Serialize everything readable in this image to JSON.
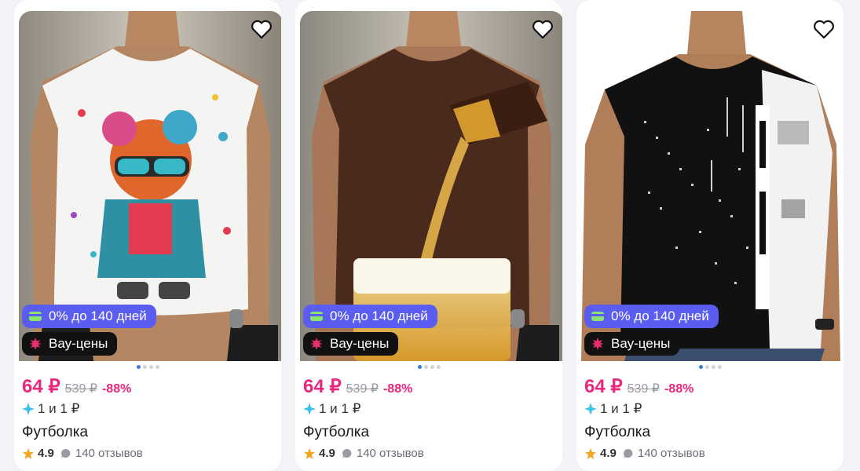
{
  "products": [
    {
      "image_desc": "teddy-bear-print-tshirt",
      "tshirt_color": "#f4f4f2",
      "installment_badge": "0% до 140 дней",
      "wow_badge": "Вау-цены",
      "price": "64 ₽",
      "old_price": "539 ₽",
      "discount": "-88%",
      "split_payment": "1 и 1 ₽",
      "title": "Футболка",
      "rating": "4.9",
      "reviews": "140 отзывов"
    },
    {
      "image_desc": "beer-pour-print-tshirt",
      "tshirt_color": "#4a2a1c",
      "installment_badge": "0% до 140 дней",
      "wow_badge": "Вау-цены",
      "price": "64 ₽",
      "old_price": "539 ₽",
      "discount": "-88%",
      "split_payment": "1 и 1 ₽",
      "title": "Футболка",
      "rating": "4.9",
      "reviews": "140 отзывов"
    },
    {
      "image_desc": "black-white-tech-print-tshirt",
      "tshirt_color": "#111111",
      "installment_badge": "0% до 140 дней",
      "wow_badge": "Вау-цены",
      "price": "64 ₽",
      "old_price": "539 ₽",
      "discount": "-88%",
      "split_payment": "1 и 1 ₽",
      "title": "Футболка",
      "rating": "4.9",
      "reviews": "140 отзывов"
    }
  ],
  "colors": {
    "price": "#e8277d",
    "installment_bg": "#5b5cf0",
    "wow_bg": "#111111",
    "star": "#f5a623",
    "dot_active": "#3a7bd5"
  },
  "icons": {
    "favorite": "heart-icon",
    "installment": "card-icon",
    "wow": "burst-icon",
    "split": "sparkle-icon",
    "rating": "star-icon",
    "reviews": "chat-bubble-icon"
  }
}
